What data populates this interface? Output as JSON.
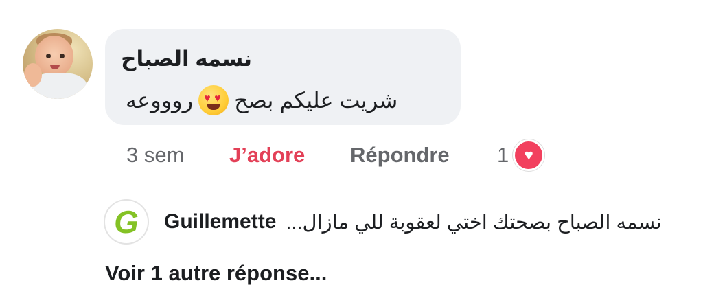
{
  "comment": {
    "author": "نسمه الصباح",
    "text_before_emoji": "روووعه",
    "emoji": "heart-eyes-emoji",
    "text_after_emoji": "شريت عليكم بصح"
  },
  "actions": {
    "time": "3 sem",
    "like_label": "J’adore",
    "reply_label": "Répondre",
    "reaction_count": "1",
    "reaction_icon": "heart-icon"
  },
  "reply": {
    "avatar_letter": "G",
    "author": "Guillemette",
    "text": "نسمه الصباح بصحتك اختي لعقوبة للي مازال..."
  },
  "more_replies": "Voir 1 autre réponse...",
  "colors": {
    "like": "#e34057",
    "bubble": "#eff1f4",
    "muted": "#65676b",
    "reaction": "#f2405e",
    "brand_green": "#84c225"
  }
}
